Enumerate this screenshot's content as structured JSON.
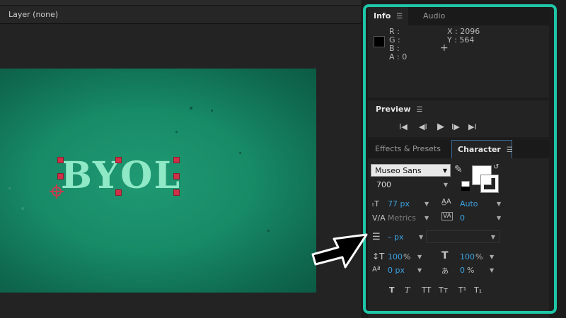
{
  "left": {
    "layer_label": "Layer (none)",
    "comp_text": "BYOL"
  },
  "colors": {
    "highlight": "#1ec6a8",
    "comp_bg": "#178a66",
    "text_fill": "#8fe8c6",
    "handle": "#d03047",
    "accent_value": "#3aa3e3"
  },
  "info": {
    "tab_info": "Info",
    "tab_audio": "Audio",
    "menu_icon": "hamburger-menu-icon",
    "r": "R :",
    "g": "G :",
    "b": "B :",
    "a": "A : 0",
    "x": "X : 2096",
    "y": "Y : 564",
    "crosshair": "+"
  },
  "preview": {
    "title": "Preview",
    "controls": [
      "first-frame-icon",
      "previous-frame-icon",
      "play-icon",
      "next-frame-icon",
      "last-frame-icon"
    ],
    "glyphs": [
      "I◀",
      "◀I",
      "▶",
      "I▶",
      "▶I"
    ]
  },
  "character": {
    "tab_effects": "Effects & Presets",
    "tab_character": "Character",
    "font_family": "Museo Sans",
    "font_style": "700",
    "font_size": "77 px",
    "leading": "Auto",
    "kerning": "Metrics",
    "tracking": "0",
    "stroke_width": "– px",
    "vertical_scale": "100",
    "vertical_scale_unit": "%",
    "horizontal_scale": "100",
    "horizontal_scale_unit": "%",
    "baseline_shift": "0 px",
    "tsume": "0",
    "tsume_unit": "%",
    "style_buttons": [
      "T",
      "T",
      "TT",
      "Tт",
      "T¹",
      "T₁"
    ]
  }
}
